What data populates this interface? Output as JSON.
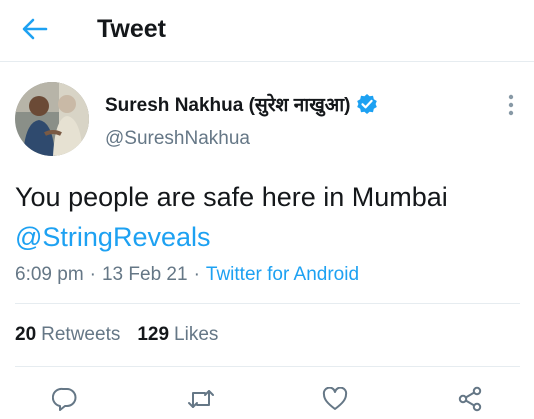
{
  "header": {
    "title": "Tweet",
    "back_icon": "arrow-left-icon"
  },
  "author": {
    "display_name": "Suresh Nakhua (सुरेश नाखुआ)",
    "handle": "@SureshNakhua",
    "verified": true,
    "verified_color": "#1da1f2"
  },
  "tweet": {
    "text": "You people are safe here in Mumbai",
    "mention": "@StringReveals",
    "time": "6:09 pm",
    "date": "13 Feb 21",
    "separator": "·",
    "source": "Twitter for Android"
  },
  "stats": {
    "retweets_count": "20",
    "retweets_label": "Retweets",
    "likes_count": "129",
    "likes_label": "Likes"
  },
  "actions": [
    "reply-icon",
    "retweet-icon",
    "like-icon",
    "share-icon"
  ],
  "colors": {
    "accent": "#1da1f2",
    "text": "#14171a",
    "secondary": "#657786",
    "divider": "#e6ecf0"
  }
}
